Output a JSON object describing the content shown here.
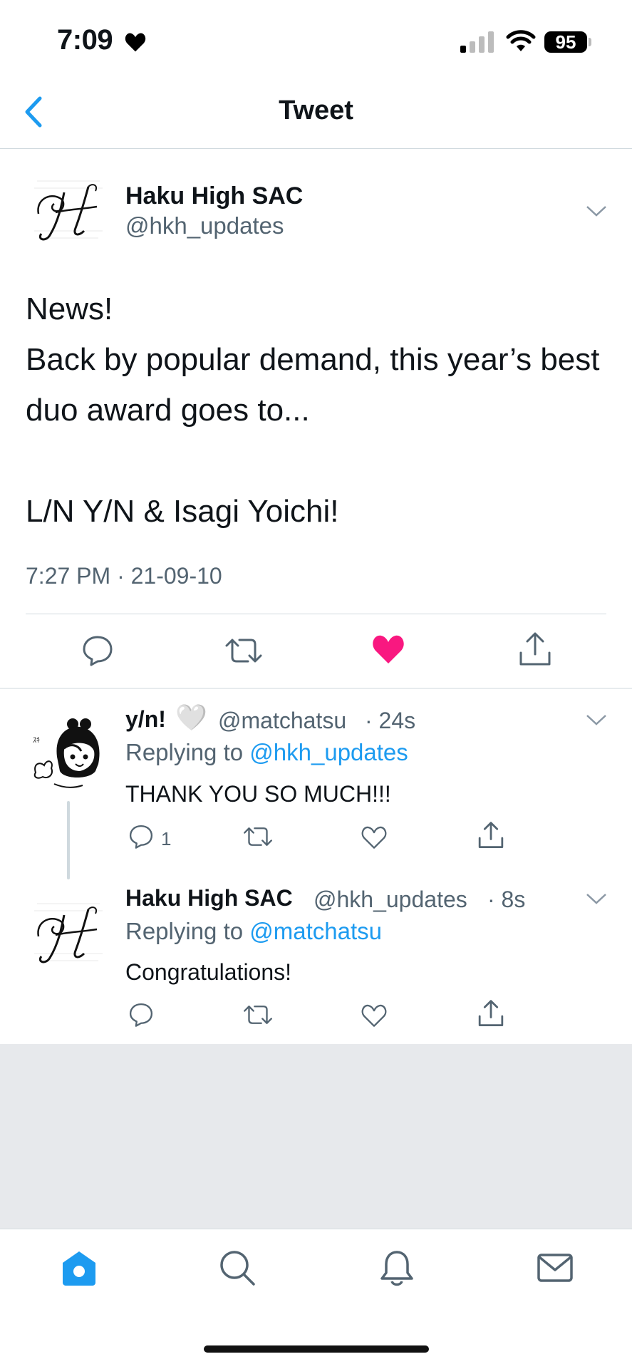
{
  "status_bar": {
    "time": "7:09",
    "battery": "95"
  },
  "nav": {
    "title": "Tweet"
  },
  "tweet": {
    "author_name": "Haku High SAC",
    "author_handle": "@hkh_updates",
    "text": "News!\nBack by popular demand, this year’s best duo award goes to...\n\nL/N Y/N & Isagi Yoichi!",
    "timestamp": "7:27 PM · 21-09-10",
    "liked": true
  },
  "replies": [
    {
      "name": "y/n!",
      "emoji": "🤍",
      "handle": "@matchatsu",
      "time": "· 24s",
      "replying_prefix": "Replying to",
      "replying_to": "@hkh_updates",
      "text": "THANK YOU SO MUCH!!!",
      "reply_count": "1"
    },
    {
      "name": "Haku High SAC",
      "handle": "@hkh_updates",
      "time": "· 8s",
      "replying_prefix": "Replying to",
      "replying_to": "@matchatsu",
      "text": "Congratulations!",
      "reply_count": ""
    }
  ],
  "tabs": [
    "home-icon",
    "search-icon",
    "bell-icon",
    "mail-icon"
  ],
  "colors": {
    "accent": "#1d9bf0",
    "like": "#f91880",
    "secondary_text": "#536471",
    "divider": "#cfd9de"
  }
}
